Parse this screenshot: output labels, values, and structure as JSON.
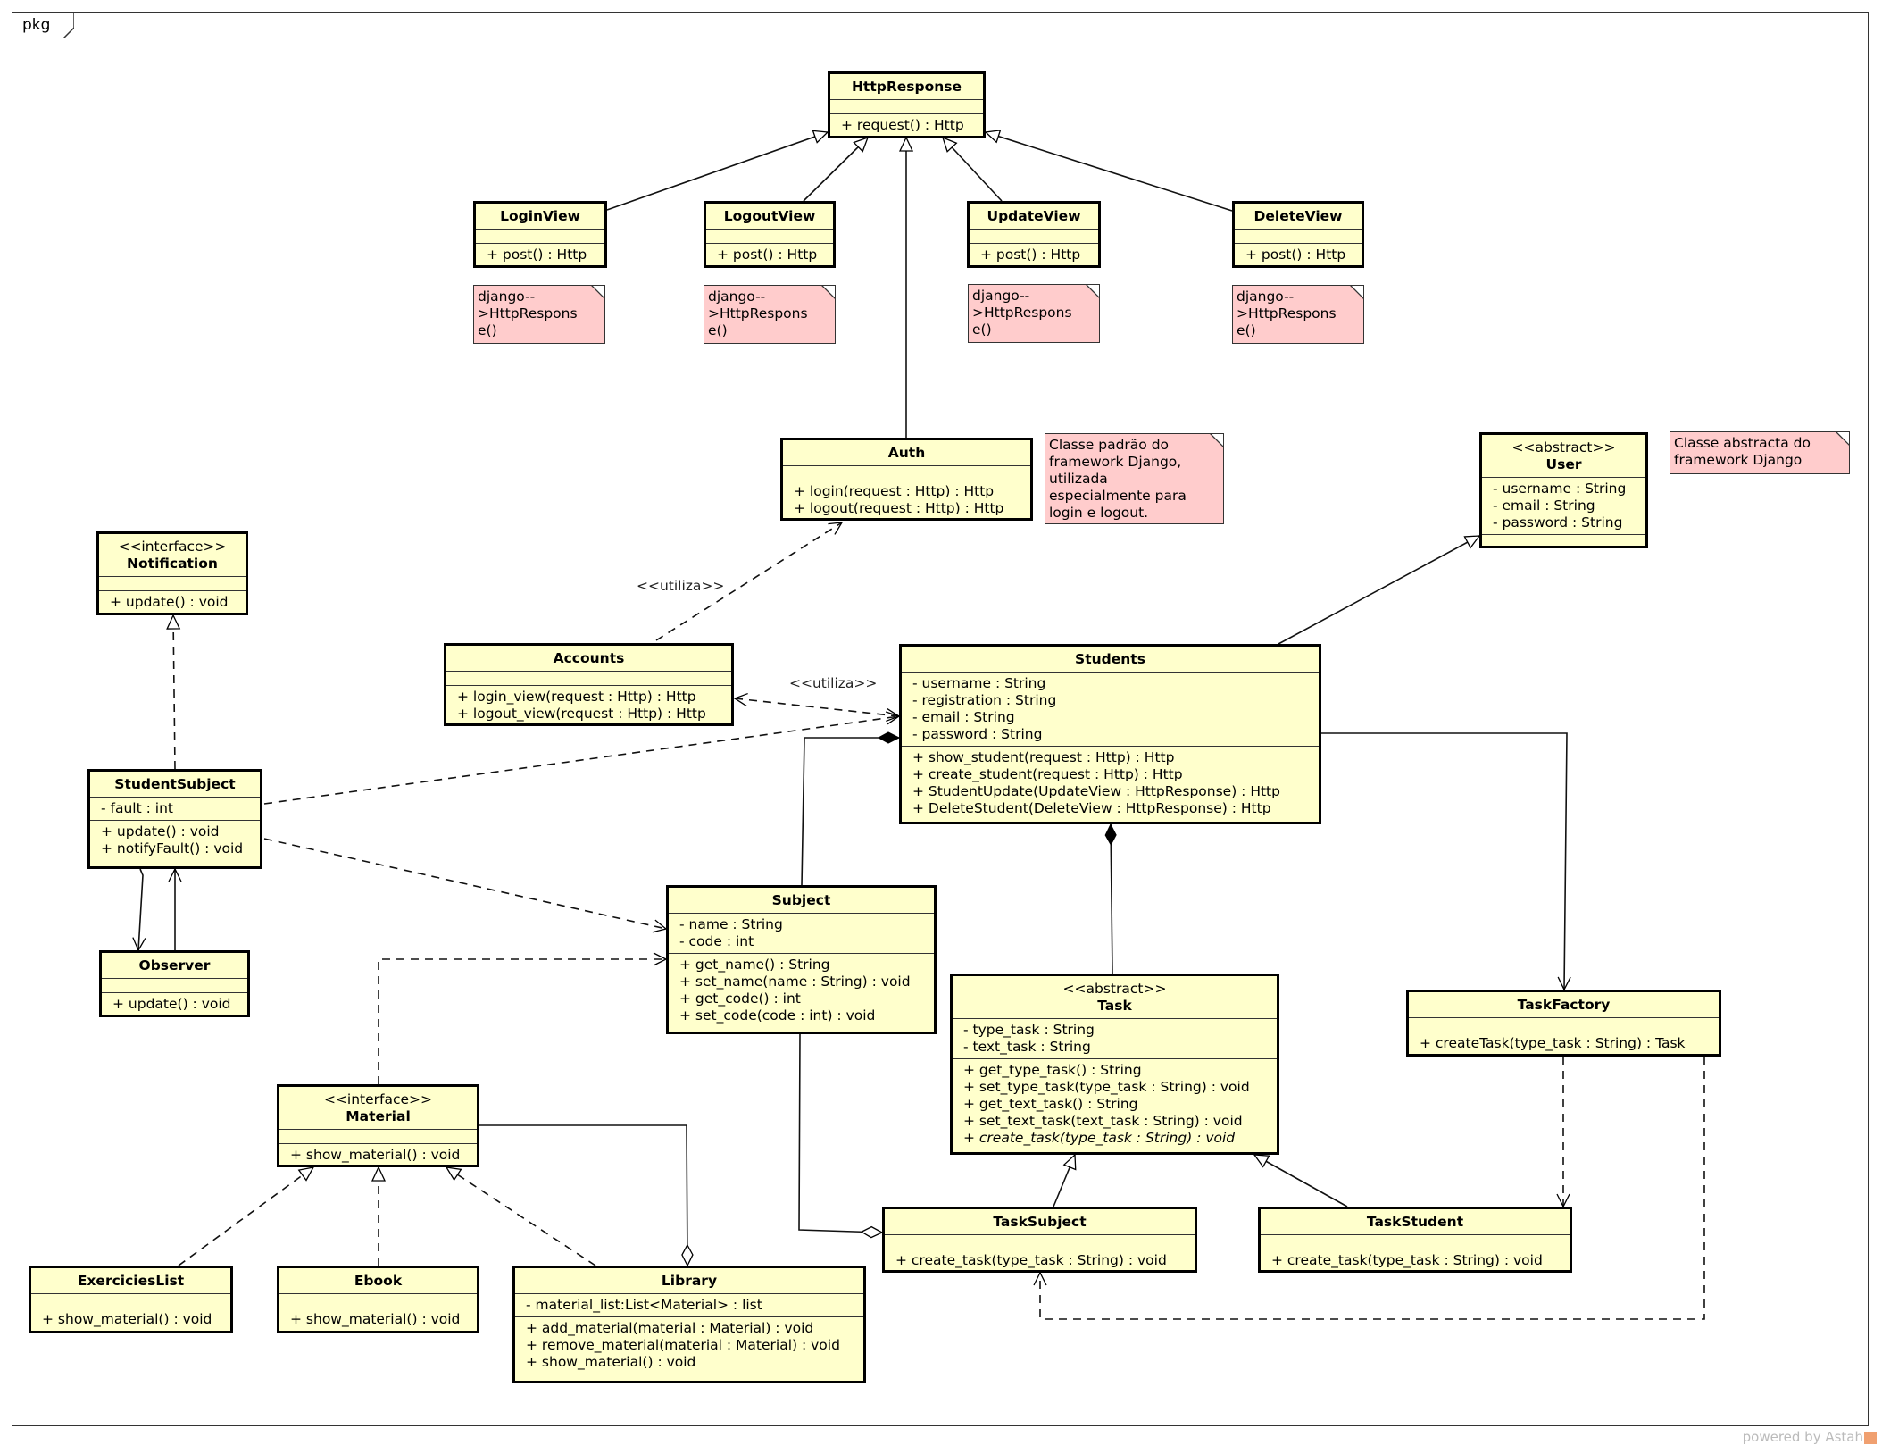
{
  "frame": {
    "label": "pkg"
  },
  "classes": {
    "httpresponse": {
      "stereotype": "",
      "name": "HttpResponse",
      "attrs": [],
      "ops": [
        "+ request() : Http"
      ]
    },
    "loginview": {
      "stereotype": "",
      "name": "LoginView",
      "attrs": [],
      "ops": [
        "+ post() : Http"
      ]
    },
    "logoutview": {
      "stereotype": "",
      "name": "LogoutView",
      "attrs": [],
      "ops": [
        "+ post() : Http"
      ]
    },
    "updateview": {
      "stereotype": "",
      "name": "UpdateView",
      "attrs": [],
      "ops": [
        "+ post() : Http"
      ]
    },
    "deleteview": {
      "stereotype": "",
      "name": "DeleteView",
      "attrs": [],
      "ops": [
        "+ post() : Http"
      ]
    },
    "auth": {
      "stereotype": "",
      "name": "Auth",
      "attrs": [],
      "ops": [
        "+ login(request : Http) : Http",
        "+ logout(request : Http) : Http"
      ]
    },
    "user": {
      "stereotype": "<<abstract>>",
      "name": "User",
      "attrs": [
        "- username : String",
        "- email : String",
        "- password : String"
      ],
      "ops": []
    },
    "notification": {
      "stereotype": "<<interface>>",
      "name": "Notification",
      "attrs": [],
      "ops": [
        "+ update() : void"
      ]
    },
    "accounts": {
      "stereotype": "",
      "name": "Accounts",
      "attrs": [],
      "ops": [
        "+ login_view(request : Http) : Http",
        "+ logout_view(request : Http) : Http"
      ]
    },
    "students": {
      "stereotype": "",
      "name": "Students",
      "attrs": [
        "- username : String",
        "- registration : String",
        "- email : String",
        "- password : String"
      ],
      "ops": [
        "+ show_student(request : Http) : Http",
        "+ create_student(request : Http) : Http",
        "+ StudentUpdate(UpdateView : HttpResponse) : Http",
        "+ DeleteStudent(DeleteView : HttpResponse) : Http"
      ]
    },
    "studentsubject": {
      "stereotype": "",
      "name": "StudentSubject",
      "attrs": [
        "- fault : int"
      ],
      "ops": [
        "+ update() : void",
        "+ notifyFault() : void"
      ]
    },
    "observer": {
      "stereotype": "",
      "name": "Observer",
      "attrs": [],
      "ops": [
        "+ update() : void"
      ]
    },
    "subject": {
      "stereotype": "",
      "name": "Subject",
      "attrs": [
        "- name : String",
        "- code : int"
      ],
      "ops": [
        "+ get_name() : String",
        "+ set_name(name : String) : void",
        "+ get_code() : int",
        "+ set_code(code : int) : void"
      ]
    },
    "task": {
      "stereotype": "<<abstract>>",
      "name": "Task",
      "attrs": [
        "- type_task : String",
        "- text_task : String"
      ],
      "ops": [
        "+ get_type_task() : String",
        "+ set_type_task(type_task : String) : void",
        "+ get_text_task() : String",
        "+ set_text_task(text_task : String) : void",
        "+ create_task(type_task : String) : void"
      ],
      "abstract_op_index": 4
    },
    "taskfactory": {
      "stereotype": "",
      "name": "TaskFactory",
      "attrs": [],
      "ops": [
        "+ createTask(type_task : String) : Task"
      ]
    },
    "material": {
      "stereotype": "<<interface>>",
      "name": "Material",
      "attrs": [],
      "ops": [
        "+ show_material() : void"
      ]
    },
    "taskSubject": {
      "stereotype": "",
      "name": "TaskSubject",
      "attrs": [],
      "ops": [
        "+ create_task(type_task : String) : void"
      ]
    },
    "taskStudent": {
      "stereotype": "",
      "name": "TaskStudent",
      "attrs": [],
      "ops": [
        "+ create_task(type_task : String) : void"
      ]
    },
    "exercicieslist": {
      "stereotype": "",
      "name": "ExerciciesList",
      "attrs": [],
      "ops": [
        "+ show_material() : void"
      ]
    },
    "ebook": {
      "stereotype": "",
      "name": "Ebook",
      "attrs": [],
      "ops": [
        "+ show_material() : void"
      ]
    },
    "library": {
      "stereotype": "",
      "name": "Library",
      "attrs": [
        "- material_list:List<Material> : list"
      ],
      "ops": [
        "+ add_material(material : Material) : void",
        "+ remove_material(material : Material) : void",
        "+ show_material() : void"
      ]
    }
  },
  "notes": {
    "login": "django--\n>HttpRespons\ne()",
    "logout": "django--\n>HttpRespons\ne()",
    "update": "django--\n>HttpRespons\ne()",
    "delete": "django--\n>HttpRespons\ne()",
    "auth": "Classe padrão do\nframework Django,\nutilizada\nespecialmente para\nlogin e logout.",
    "user": "Classe abstracta do\nframework Django"
  },
  "edge_labels": {
    "accounts_auth": "<<utiliza>>",
    "students_accounts": "<<utiliza>>"
  },
  "relationships": [
    {
      "from": "LoginView",
      "to": "HttpResponse",
      "type": "generalization"
    },
    {
      "from": "LogoutView",
      "to": "HttpResponse",
      "type": "generalization"
    },
    {
      "from": "Auth",
      "to": "HttpResponse",
      "type": "generalization"
    },
    {
      "from": "UpdateView",
      "to": "HttpResponse",
      "type": "generalization"
    },
    {
      "from": "DeleteView",
      "to": "HttpResponse",
      "type": "generalization"
    },
    {
      "from": "Students",
      "to": "User",
      "type": "generalization"
    },
    {
      "from": "Accounts",
      "to": "Auth",
      "type": "dependency",
      "label": "<<utiliza>>"
    },
    {
      "from": "Students",
      "to": "Accounts",
      "type": "dependency",
      "label": "<<utiliza>>",
      "bidirectional": true
    },
    {
      "from": "StudentSubject",
      "to": "Notification",
      "type": "realization"
    },
    {
      "from": "StudentSubject",
      "to": "Students",
      "type": "dependency"
    },
    {
      "from": "StudentSubject",
      "to": "Subject",
      "type": "dependency"
    },
    {
      "from": "StudentSubject",
      "to": "Observer",
      "type": "association"
    },
    {
      "from": "Observer",
      "to": "StudentSubject",
      "type": "association"
    },
    {
      "from": "Students",
      "to": "Subject",
      "type": "composition"
    },
    {
      "from": "Students",
      "to": "Task",
      "type": "composition"
    },
    {
      "from": "Students",
      "to": "TaskFactory",
      "type": "association"
    },
    {
      "from": "Material",
      "to": "Subject",
      "type": "dependency"
    },
    {
      "from": "Library",
      "to": "Material",
      "type": "aggregation"
    },
    {
      "from": "TaskSubject",
      "to": "Subject",
      "type": "aggregation"
    },
    {
      "from": "TaskSubject",
      "to": "Task",
      "type": "generalization"
    },
    {
      "from": "TaskStudent",
      "to": "Task",
      "type": "generalization"
    },
    {
      "from": "TaskFactory",
      "to": "TaskStudent",
      "type": "dependency"
    },
    {
      "from": "TaskFactory",
      "to": "TaskSubject",
      "type": "dependency"
    },
    {
      "from": "ExerciciesList",
      "to": "Material",
      "type": "realization"
    },
    {
      "from": "Ebook",
      "to": "Material",
      "type": "realization"
    },
    {
      "from": "Library",
      "to": "Material",
      "type": "realization"
    }
  ],
  "watermark": "powered by Astah"
}
